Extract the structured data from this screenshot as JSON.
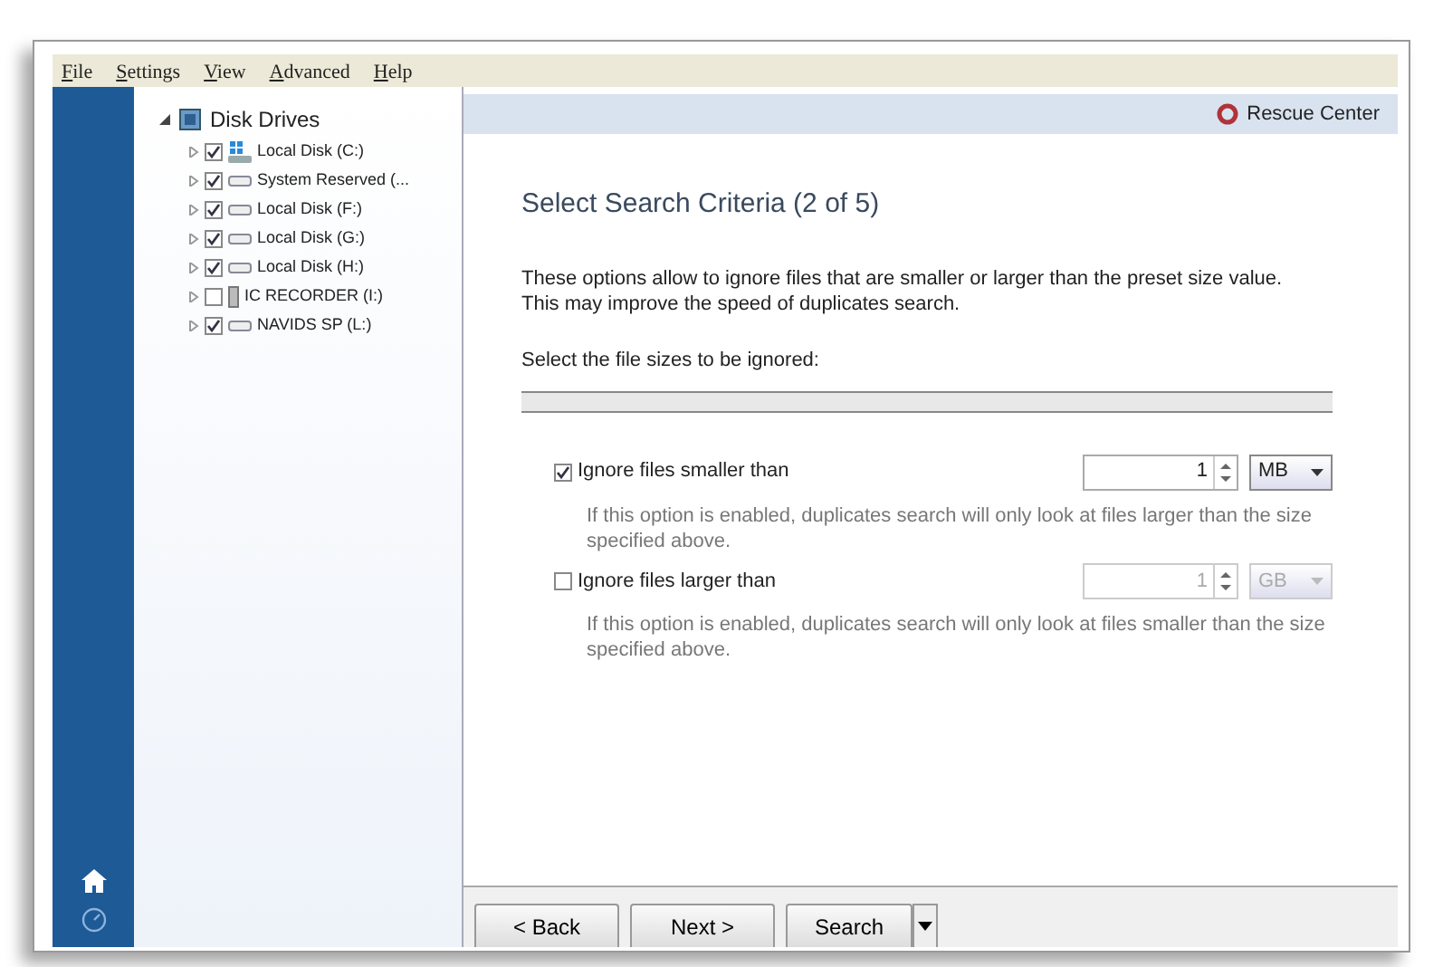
{
  "menu": [
    {
      "label": "File"
    },
    {
      "label": "Settings"
    },
    {
      "label": "View"
    },
    {
      "label": "Advanced"
    },
    {
      "label": "Help"
    }
  ],
  "tree": {
    "label": "Disk Drives",
    "expanded": true,
    "children": [
      {
        "label": "Local Disk (C:)",
        "kind": "system",
        "checked": true
      },
      {
        "label": "System Reserved (...",
        "kind": "disk",
        "checked": true
      },
      {
        "label": "Local Disk (F:)",
        "kind": "disk",
        "checked": true
      },
      {
        "label": "Local Disk (G:)",
        "kind": "disk",
        "checked": true
      },
      {
        "label": "Local Disk (H:)",
        "kind": "disk",
        "checked": true
      },
      {
        "label": "IC RECORDER (I:)",
        "kind": "recorder",
        "checked": false
      },
      {
        "label": "NAVIDS SP (L:)",
        "kind": "disk",
        "checked": true
      }
    ]
  },
  "header": {
    "link": "Rescue Center"
  },
  "page": {
    "title": "Select Search Criteria (2 of 5)",
    "intro": "These options allow to ignore files that are smaller or larger than the preset size value. This may improve the speed of duplicates search.",
    "section": "Select the file sizes to be ignored:"
  },
  "options": [
    {
      "label": "Ignore files smaller than",
      "checked": true,
      "value": "1",
      "unit": "MB",
      "description": "If this option is enabled, duplicates search will only look at files larger than the size specified above."
    },
    {
      "label": "Ignore files larger than",
      "checked": false,
      "value": "1",
      "unit": "GB",
      "description": "If this option is enabled, duplicates search will only look at files smaller than the size specified above."
    }
  ],
  "buttons": [
    {
      "label": "< Back",
      "kind": "plain"
    },
    {
      "label": "Next >",
      "kind": "plain"
    },
    {
      "label": "Search",
      "kind": "split"
    }
  ]
}
